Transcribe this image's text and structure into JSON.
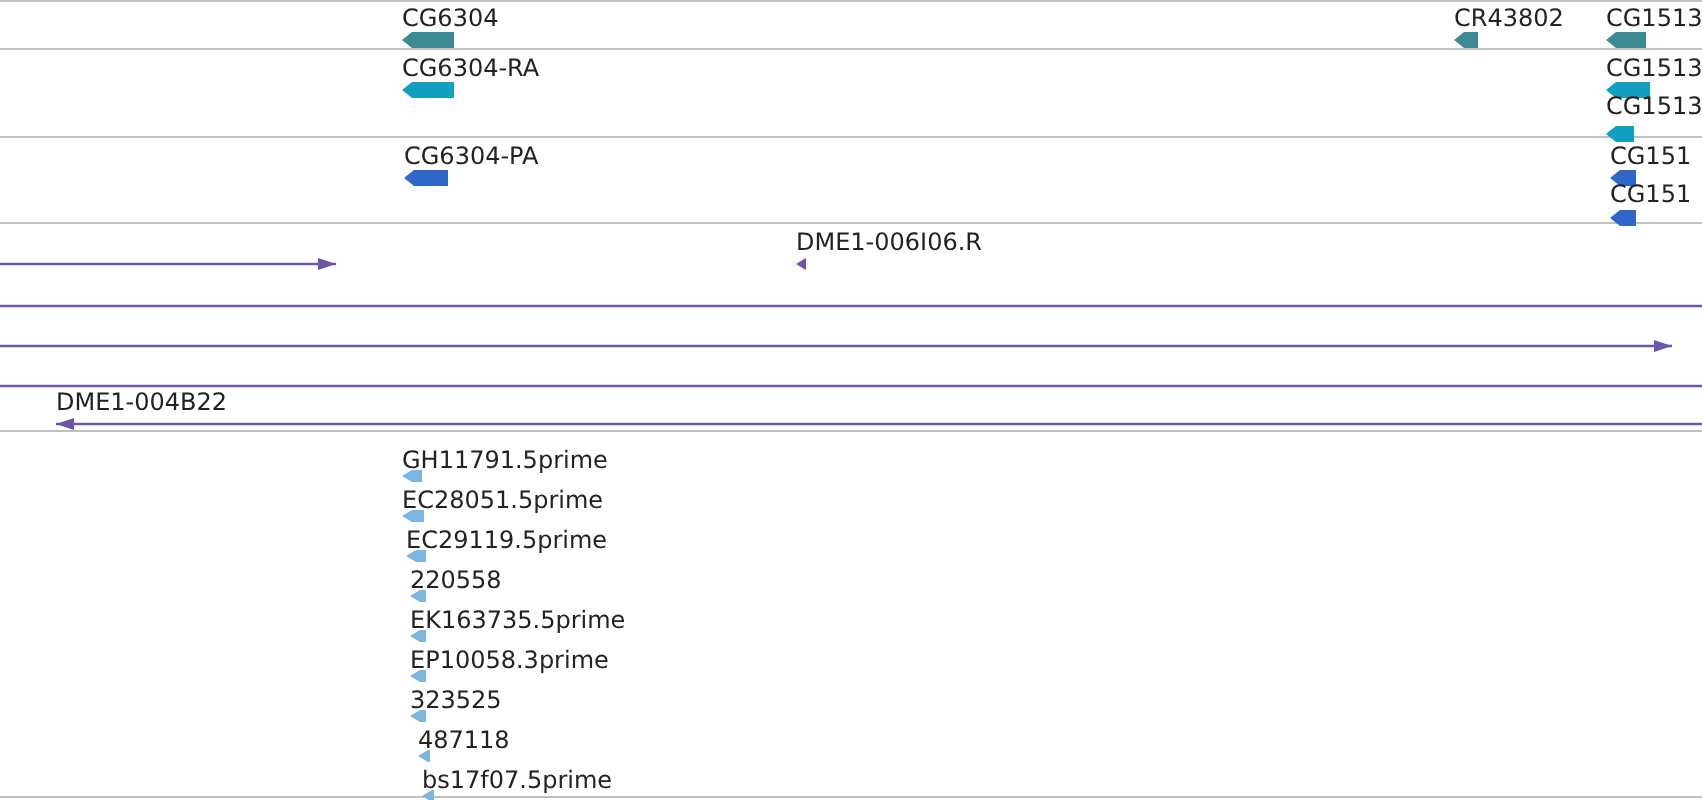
{
  "tracks": [
    {
      "kind": "gene",
      "color": "#3a8c90",
      "features": [
        {
          "label": "CG6304",
          "reverse": true
        },
        {
          "label": "CR43802",
          "reverse": true
        },
        {
          "label": "CG1513",
          "reverse": true
        }
      ]
    },
    {
      "kind": "gene",
      "color": "#12a0c2",
      "features": [
        {
          "label": "CG6304-RA",
          "reverse": true
        },
        {
          "label": "CG1513",
          "reverse": true
        },
        {
          "label": "CG1513",
          "reverse": true
        }
      ]
    },
    {
      "kind": "gene",
      "color": "#2f66c9",
      "features": [
        {
          "label": "CG6304-PA",
          "reverse": true
        },
        {
          "label": "CG151",
          "reverse": true
        },
        {
          "label": "CG151",
          "reverse": true
        }
      ]
    },
    {
      "kind": "alignment",
      "color": "#6f55a8",
      "features": [
        {
          "kind": "arrow",
          "reverse": false
        },
        {
          "kind": "arrow",
          "label": "DME1-006I06.R",
          "reverse": true
        },
        {
          "kind": "line"
        },
        {
          "kind": "arrow",
          "reverse": false
        },
        {
          "kind": "line"
        },
        {
          "kind": "arrow",
          "label": "DME1-004B22",
          "reverse": true
        }
      ]
    },
    {
      "kind": "est",
      "color": "#7cb6e0",
      "features": [
        {
          "label": "GH11791.5prime",
          "reverse": true
        },
        {
          "label": "EC28051.5prime",
          "reverse": true
        },
        {
          "label": "EC29119.5prime",
          "reverse": true
        },
        {
          "label": "220558",
          "reverse": true
        },
        {
          "label": "EK163735.5prime",
          "reverse": true
        },
        {
          "label": "EP10058.3prime",
          "reverse": true
        },
        {
          "label": "323525",
          "reverse": true
        },
        {
          "label": "487118",
          "reverse": true
        },
        {
          "label": "bs17f07.5prime",
          "reverse": true
        }
      ]
    }
  ]
}
